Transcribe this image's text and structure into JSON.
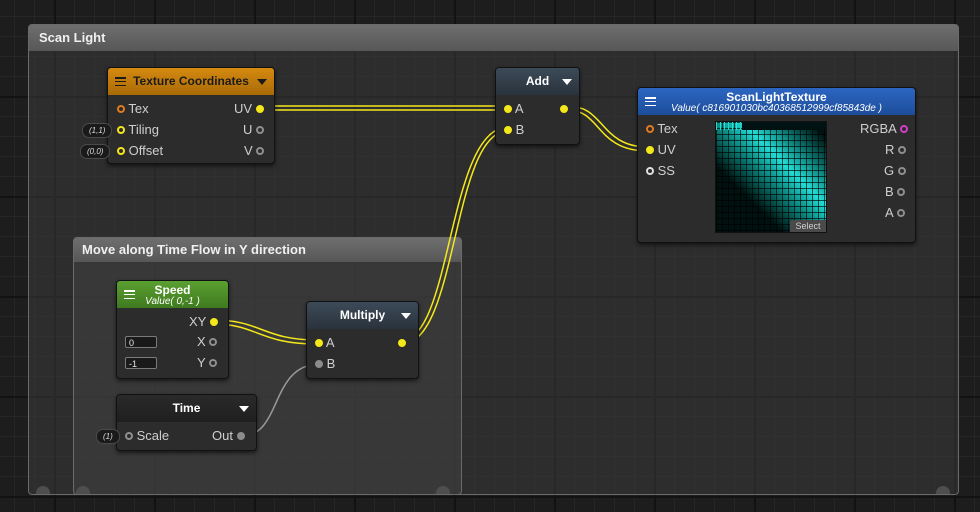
{
  "groups": {
    "scan_light": {
      "title": "Scan Light"
    },
    "move_along": {
      "title": "Move along Time Flow in Y direction"
    }
  },
  "nodes": {
    "texture_coordinates": {
      "title": "Texture Coordinates",
      "inputs": {
        "tex": "Tex",
        "tiling": "Tiling",
        "offset": "Offset"
      },
      "outputs": {
        "uv": "UV",
        "u": "U",
        "v": "V"
      },
      "defaults": {
        "tiling": "(1,1)",
        "offset": "(0,0)"
      }
    },
    "add": {
      "title": "Add",
      "inputs": {
        "a": "A",
        "b": "B"
      }
    },
    "scan_light_texture": {
      "title": "ScanLightTexture",
      "subtitle": "Value( c816901030bc40368512999cf85843de )",
      "inputs": {
        "tex": "Tex",
        "uv": "UV",
        "ss": "SS"
      },
      "outputs": {
        "rgba": "RGBA",
        "r": "R",
        "g": "G",
        "b": "B",
        "a": "A"
      },
      "select_label": "Select"
    },
    "speed": {
      "title": "Speed",
      "subtitle": "Value( 0,-1 )",
      "outputs": {
        "xy": "XY",
        "x": "X",
        "y": "Y"
      },
      "fields": {
        "x": "0",
        "y": "-1"
      }
    },
    "multiply": {
      "title": "Multiply",
      "inputs": {
        "a": "A",
        "b": "B"
      }
    },
    "time": {
      "title": "Time",
      "inputs": {
        "scale": "Scale"
      },
      "outputs": {
        "out": "Out"
      },
      "defaults": {
        "scale": "(1)"
      }
    }
  },
  "colors": {
    "wire_vector": "#f5e81a",
    "wire_float": "#9a9a9a",
    "port_texture": "#e07a1e",
    "port_sampler_state": "#e0e0e0",
    "port_rgba": "#d23ec8",
    "texture_coordinates_header": "#c87f0c",
    "scan_light_texture_header": "#2559b0",
    "speed_header": "#4f8e2a"
  },
  "icons": {
    "node_menu": "hamburger-menu-icon",
    "node_collapse": "caret-down-icon"
  }
}
